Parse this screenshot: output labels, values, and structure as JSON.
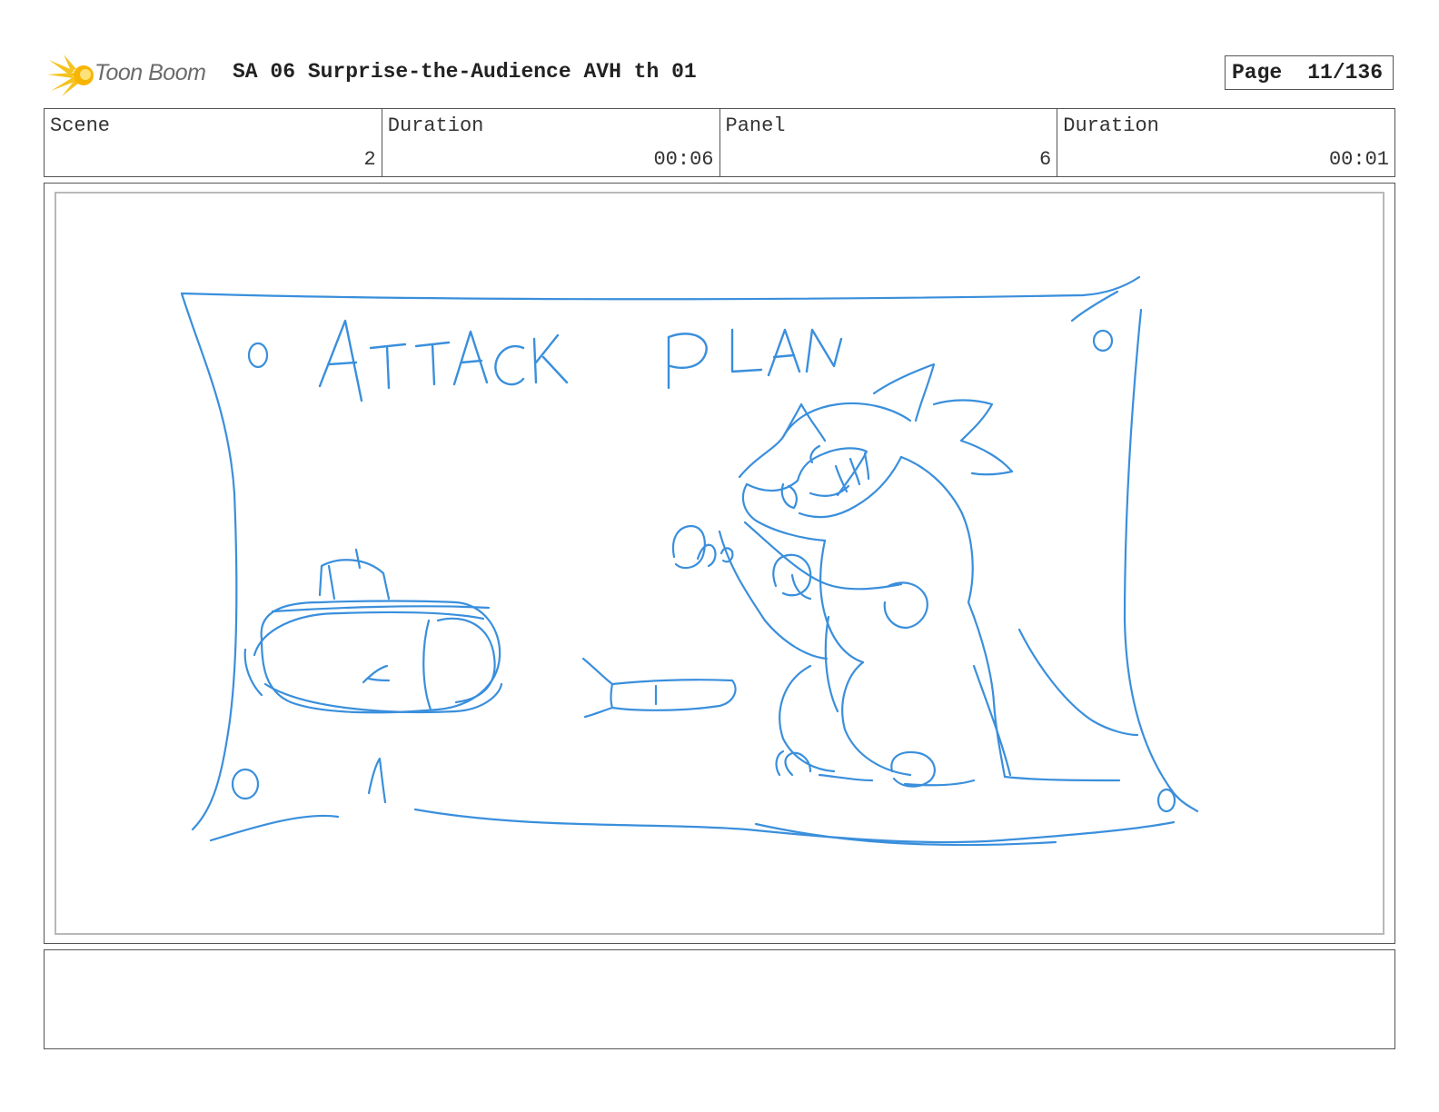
{
  "header": {
    "brand": "Toon Boom",
    "title": "SA 06 Surprise-the-Audience AVH th 01",
    "page_label": "Page",
    "page_number": "11/136"
  },
  "info": {
    "scene_label": "Scene",
    "scene_value": "2",
    "scene_duration_label": "Duration",
    "scene_duration_value": "00:06",
    "panel_label": "Panel",
    "panel_value": "6",
    "panel_duration_label": "Duration",
    "panel_duration_value": "00:01"
  },
  "sketch": {
    "text": "ATTACK PLAN",
    "stroke_color": "#3a8fdc"
  },
  "notes": {
    "text": ""
  }
}
